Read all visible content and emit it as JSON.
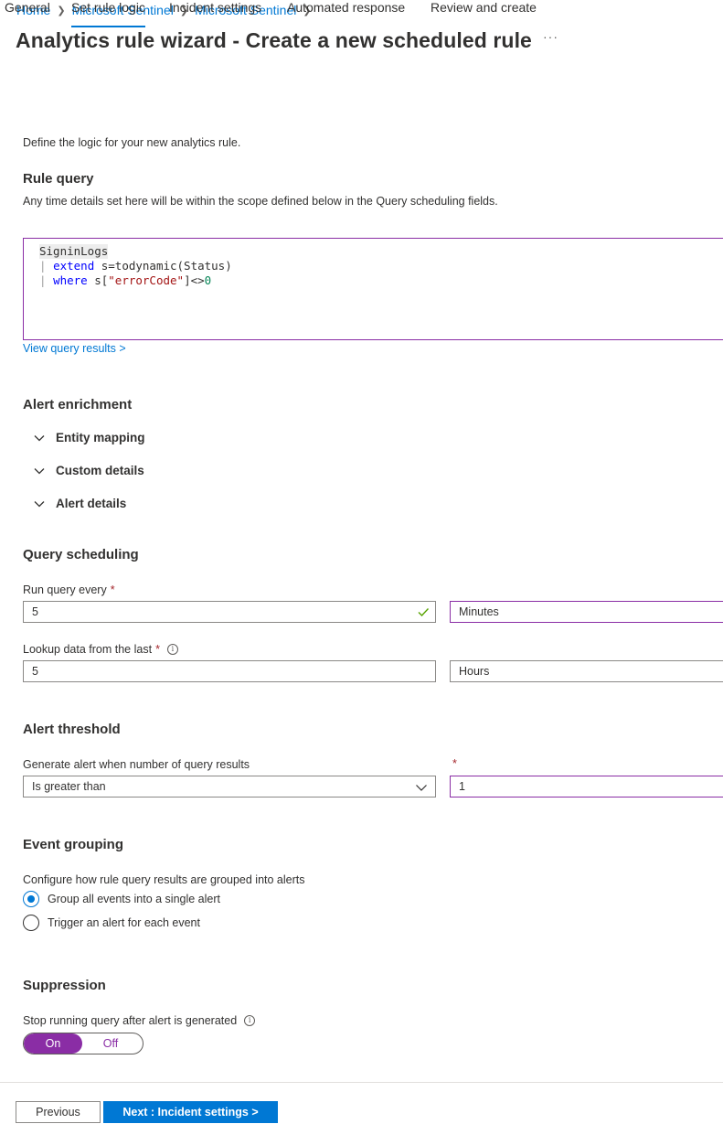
{
  "breadcrumb": [
    "Home",
    "Microsoft Sentinel",
    "Microsoft Sentinel"
  ],
  "page_title": "Analytics rule wizard - Create a new scheduled rule",
  "more_label": "···",
  "tabs": [
    "General",
    "Set rule logic",
    "Incident settings",
    "Automated response",
    "Review and create"
  ],
  "active_tab": "Set rule logic",
  "intro": "Define the logic for your new analytics rule.",
  "rule_query": {
    "title": "Rule query",
    "desc": "Any time details set here will be within the scope defined below in the Query scheduling fields.",
    "line1": "SigninLogs",
    "line2_pipe": "|",
    "line2_kw": "extend",
    "line2_rest": " s=todynamic(Status)",
    "line3_pipe": "|",
    "line3_kw": "where",
    "line3_a": " s[",
    "line3_str": "\"errorCode\"",
    "line3_b": "]<>",
    "line3_num": "0",
    "view_results": "View query results >"
  },
  "alert_enrichment": {
    "title": "Alert enrichment",
    "items": [
      "Entity mapping",
      "Custom details",
      "Alert details"
    ]
  },
  "query_scheduling": {
    "title": "Query scheduling",
    "run_label": "Run query every",
    "run_value": "5",
    "run_unit": "Minutes",
    "lookup_label": "Lookup data from the last",
    "lookup_value": "5",
    "lookup_unit": "Hours",
    "required_mark": "*",
    "info_glyph": "i"
  },
  "alert_threshold": {
    "title": "Alert threshold",
    "label": "Generate alert when number of query results",
    "operator": "Is greater than",
    "required_mark": "*",
    "value": "1"
  },
  "event_grouping": {
    "title": "Event grouping",
    "desc": "Configure how rule query results are grouped into alerts",
    "options": [
      "Group all events into a single alert",
      "Trigger an alert for each event"
    ],
    "selected": 0
  },
  "suppression": {
    "title": "Suppression",
    "label": "Stop running query after alert is generated",
    "on_label": "On",
    "off_label": "Off",
    "info_glyph": "i"
  },
  "footer": {
    "previous": "Previous",
    "next": "Next : Incident settings >"
  },
  "colors": {
    "accent": "#0078d4",
    "focus_border": "#8a2da5",
    "required": "#a4262c"
  }
}
